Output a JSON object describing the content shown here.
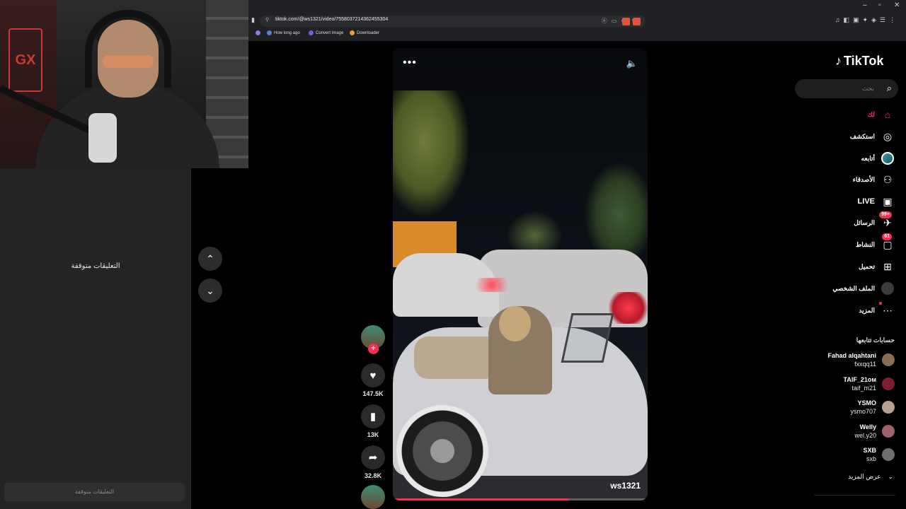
{
  "browser": {
    "url": "tiktok.com/@ws1321/video/7558037214362455304",
    "bookmarks": [
      "How long ago",
      "Convert Image",
      "Downloader"
    ],
    "window_controls": [
      "–",
      "▫",
      "✕"
    ]
  },
  "comments_panel": {
    "status": "التعليقات متوقفة",
    "input_placeholder": "التعليقات متوقفة"
  },
  "video": {
    "username": "ws1321",
    "more_icon": "•••",
    "sound_icon": "speaker-icon",
    "progress": 0.69
  },
  "actions": {
    "likes": "147.5K",
    "saves": "13K",
    "shares": "32.8K"
  },
  "sidebar": {
    "logo": "TikTok",
    "search_placeholder": "بحث",
    "nav": [
      {
        "label": "لك",
        "icon": "home-icon",
        "active": true
      },
      {
        "label": "استكشف",
        "icon": "compass-icon"
      },
      {
        "label": "أتابعه",
        "icon": "following-avatar-icon"
      },
      {
        "label": "الأصدقاء",
        "icon": "friends-icon"
      },
      {
        "label": "LIVE",
        "icon": "live-icon"
      },
      {
        "label": "الرسائل",
        "icon": "messages-icon",
        "badge": "99+"
      },
      {
        "label": "النشاط",
        "icon": "activity-icon",
        "badge": "61"
      },
      {
        "label": "تحميل",
        "icon": "upload-icon"
      },
      {
        "label": "الملف الشخصي",
        "icon": "profile-icon"
      },
      {
        "label": "المزيد",
        "icon": "more-icon"
      }
    ],
    "following_title": "حسابات تتابعها",
    "following": [
      {
        "name": "Fahad alqahtani",
        "handle": "fxxqq11"
      },
      {
        "name": "TAIF_21ᴏᴍ",
        "handle": "taif_m21"
      },
      {
        "name": "YSMO",
        "handle": "ysmo707"
      },
      {
        "name": "Welly",
        "handle": "wel.y20"
      },
      {
        "name": "SXB",
        "handle": "sxb"
      }
    ],
    "see_more": "عرض المزيد"
  }
}
